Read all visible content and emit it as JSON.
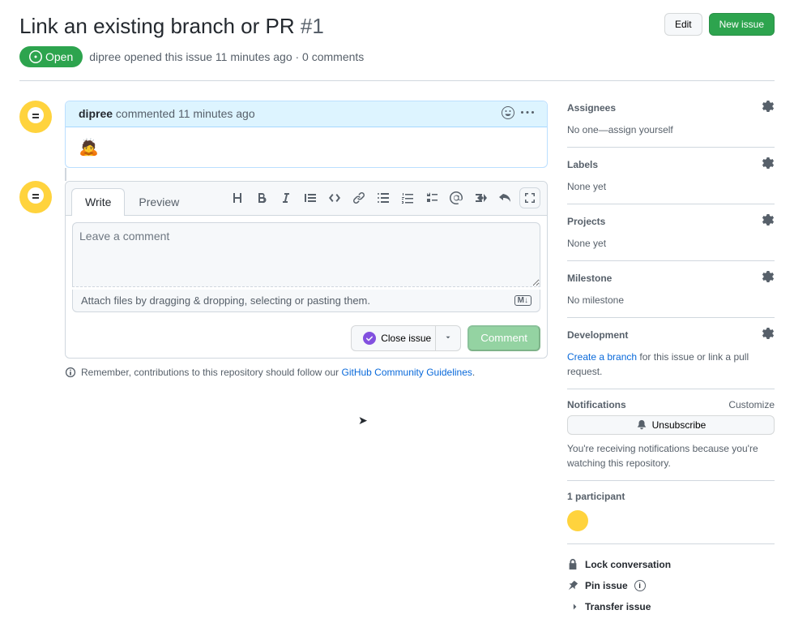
{
  "header": {
    "title": "Link an existing branch or PR",
    "issue_number": "#1",
    "edit_btn": "Edit",
    "new_issue_btn": "New issue",
    "status": "Open",
    "author": "dipree",
    "meta_rest": "opened this issue 11 minutes ago · 0 comments"
  },
  "comment": {
    "author": "dipree",
    "time_text": "commented 11 minutes ago",
    "body_emoji": "🙇"
  },
  "compose": {
    "tab_write": "Write",
    "tab_preview": "Preview",
    "placeholder": "Leave a comment",
    "attach_text": "Attach files by dragging & dropping, selecting or pasting them.",
    "close_btn": "Close issue",
    "comment_btn": "Comment"
  },
  "footer": {
    "text_pre": "Remember, contributions to this repository should follow our ",
    "link": "GitHub Community Guidelines",
    "text_post": "."
  },
  "sidebar": {
    "assignees": {
      "title": "Assignees",
      "body": "No one—",
      "link": "assign yourself"
    },
    "labels": {
      "title": "Labels",
      "body": "None yet"
    },
    "projects": {
      "title": "Projects",
      "body": "None yet"
    },
    "milestone": {
      "title": "Milestone",
      "body": "No milestone"
    },
    "development": {
      "title": "Development",
      "link": "Create a branch",
      "rest": " for this issue or link a pull request."
    },
    "notifications": {
      "title": "Notifications",
      "customize": "Customize",
      "unsubscribe": "Unsubscribe",
      "note": "You're receiving notifications because you're watching this repository."
    },
    "participants": {
      "title": "1 participant"
    },
    "actions": {
      "lock": "Lock conversation",
      "pin": "Pin issue",
      "transfer": "Transfer issue"
    }
  }
}
